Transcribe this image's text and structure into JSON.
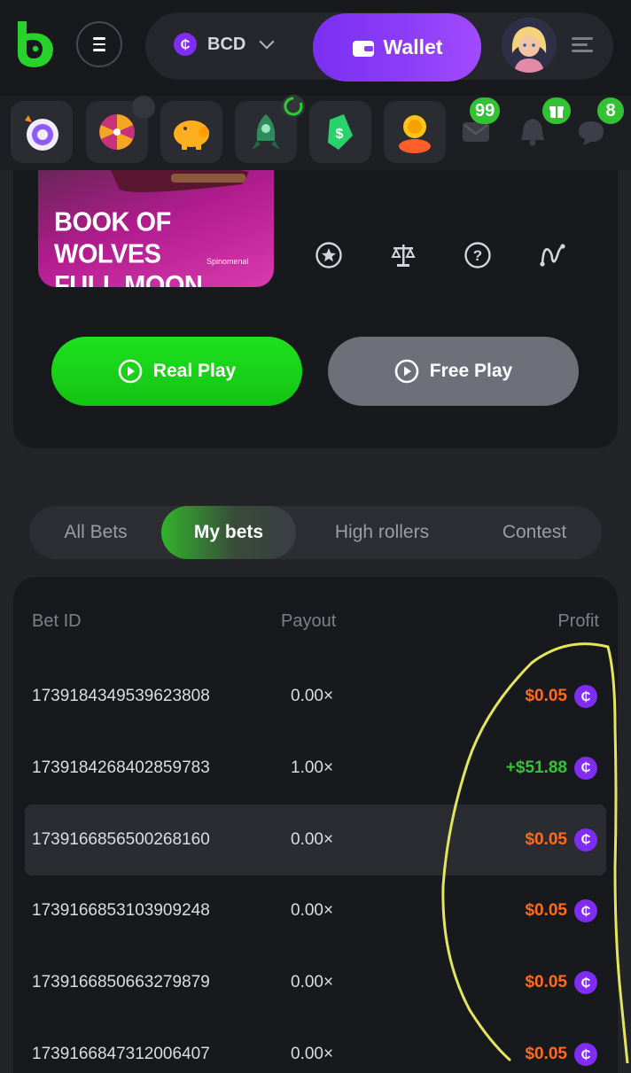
{
  "header": {
    "currency_code": "BCD",
    "currency_symbol": "₵",
    "wallet_label": "Wallet"
  },
  "promo_bar": {
    "mail_badge": "99",
    "chat_badge": "8"
  },
  "game": {
    "title_line1": "BOOK OF WOLVES",
    "title_line2": "FULL MOON",
    "provider": "Spinomenal",
    "real_play_label": "Real Play",
    "free_play_label": "Free Play"
  },
  "tabs": [
    {
      "label": "All Bets",
      "active": false
    },
    {
      "label": "My bets",
      "active": true
    },
    {
      "label": "High rollers",
      "active": false
    },
    {
      "label": "Contest",
      "active": false
    }
  ],
  "table": {
    "headers": {
      "bet_id": "Bet ID",
      "payout": "Payout",
      "profit": "Profit"
    },
    "rows": [
      {
        "bet_id": "1739184349539623808",
        "payout": "0.00×",
        "profit": "$0.05",
        "status": "loss"
      },
      {
        "bet_id": "1739184268402859783",
        "payout": "1.00×",
        "profit": "+$51.88",
        "status": "win"
      },
      {
        "bet_id": "1739166856500268160",
        "payout": "0.00×",
        "profit": "$0.05",
        "status": "loss"
      },
      {
        "bet_id": "1739166853103909248",
        "payout": "0.00×",
        "profit": "$0.05",
        "status": "loss"
      },
      {
        "bet_id": "1739166850663279879",
        "payout": "0.00×",
        "profit": "$0.05",
        "status": "loss"
      },
      {
        "bet_id": "1739166847312006407",
        "payout": "0.00×",
        "profit": "$0.05",
        "status": "loss"
      }
    ]
  },
  "colors": {
    "accent_green": "#1fe01f",
    "accent_purple": "#7a2ff2",
    "loss": "#ff6b1a",
    "win": "#36c236",
    "annotation": "#e4e65a"
  }
}
